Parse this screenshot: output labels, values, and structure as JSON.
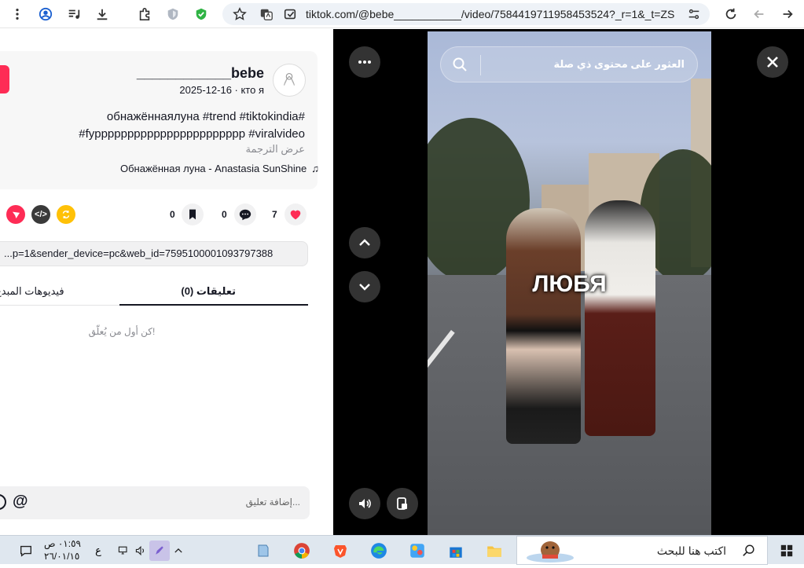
{
  "browser": {
    "url": "tiktok.com/@bebe___________/video/7584419711958453524?_r=1&_t=ZS-..."
  },
  "post": {
    "username": "____________bebe",
    "date_line": "2025-12-16 · кто я",
    "description_line1": "обнажённаялуна #trend #tiktokindia#",
    "description_line2": "#fyppppppppppppppppppppppp #viralvideo",
    "translate": "عرض الترجمة",
    "music": "Обнажённая луна - Anastasia SunShine",
    "likes": "7",
    "comments": "0",
    "saves": "0",
    "link": "...p=1&sender_device=pc&web_id=7595100001093797388"
  },
  "tabs": {
    "comments": "(0) تعليقات",
    "other": "فيديوهات المبدع"
  },
  "empty_comments": "كن أول من يُعلّق!",
  "comment_placeholder": "إضافة تعليق...",
  "video": {
    "search_placeholder": "العثور على محتوى ذي صلة",
    "overlay_text": "ЛЮБЯ"
  },
  "taskbar": {
    "time": "٠١:٥٩ ص",
    "date": "٢٦/٠١/١٥",
    "lang": "ع",
    "search_text": "اكتب هنا للبحث"
  },
  "colors": {
    "accent": "#fe2c55",
    "dark": "#161823"
  }
}
